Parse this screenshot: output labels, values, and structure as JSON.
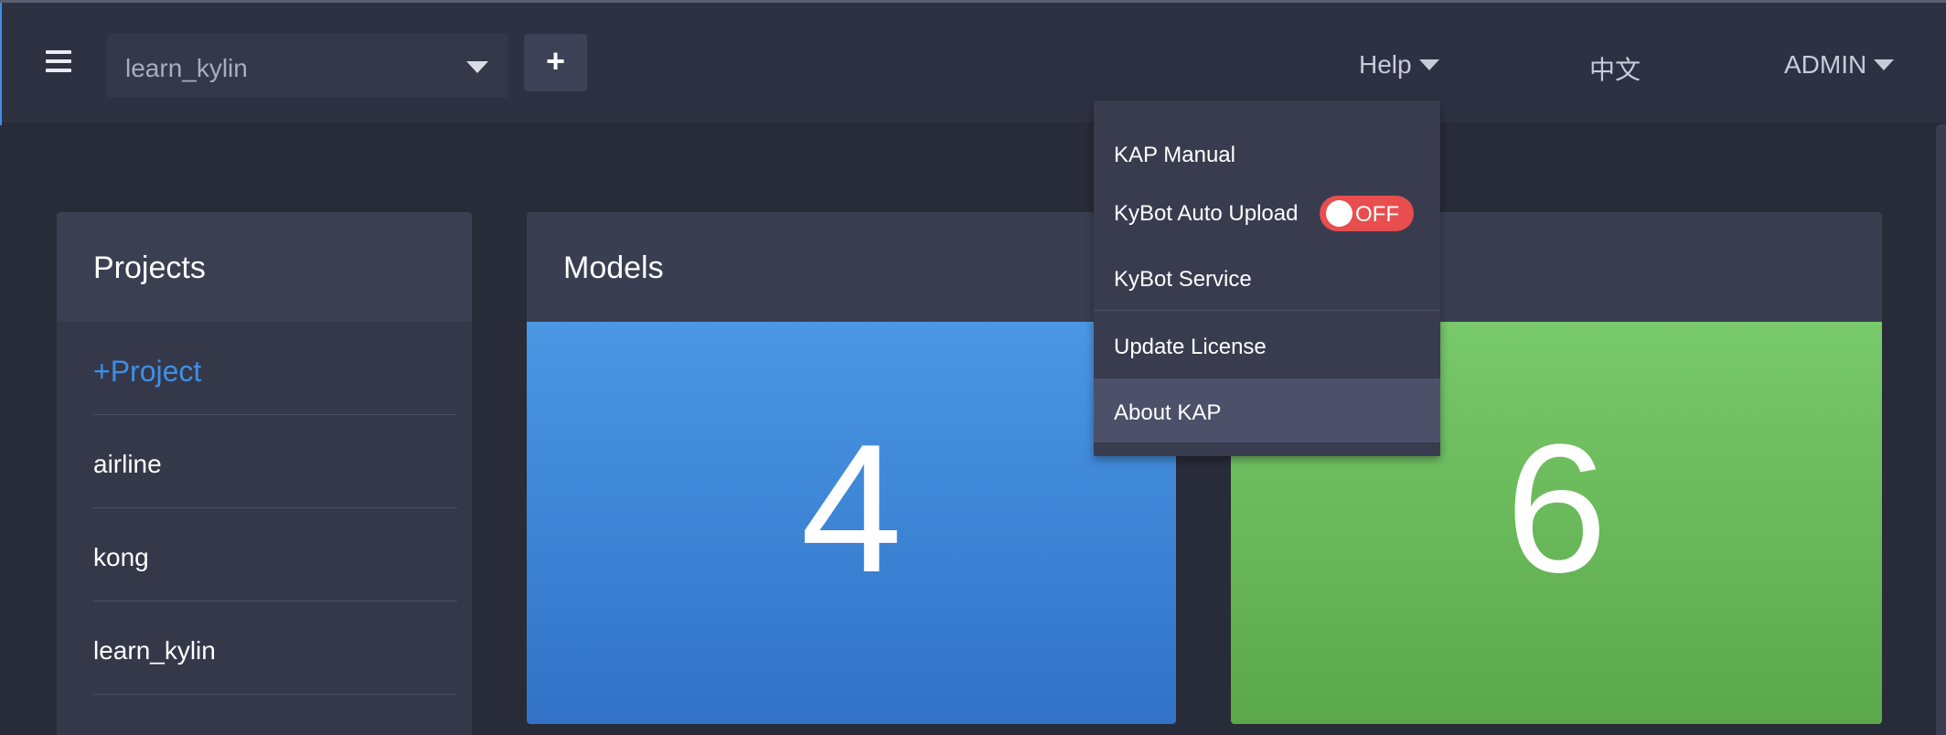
{
  "header": {
    "selected_project": "learn_kylin",
    "add_label": "+",
    "help_label": "Help",
    "language_label": "中文",
    "user_label": "ADMIN"
  },
  "projects_panel": {
    "title": "Projects",
    "add_project_label": "+Project",
    "items": [
      "airline",
      "kong",
      "learn_kylin"
    ]
  },
  "models_panel": {
    "title": "Models",
    "count": "4"
  },
  "cubes_panel": {
    "count": "6"
  },
  "help_menu": {
    "items": {
      "manual": "KAP Manual",
      "kybot_auto_upload": "KyBot Auto Upload",
      "kybot_service": "KyBot Service",
      "update_license": "Update License",
      "about": "About KAP"
    },
    "toggle_state": "OFF"
  },
  "colors": {
    "background": "#282b38",
    "topbar": "#2e3142",
    "panel": "#353849",
    "accent_blue": "#3d8fe6",
    "models_blue": "#4a97e4",
    "cubes_green": "#78c96b",
    "toggle_off_red": "#e84e4e"
  }
}
